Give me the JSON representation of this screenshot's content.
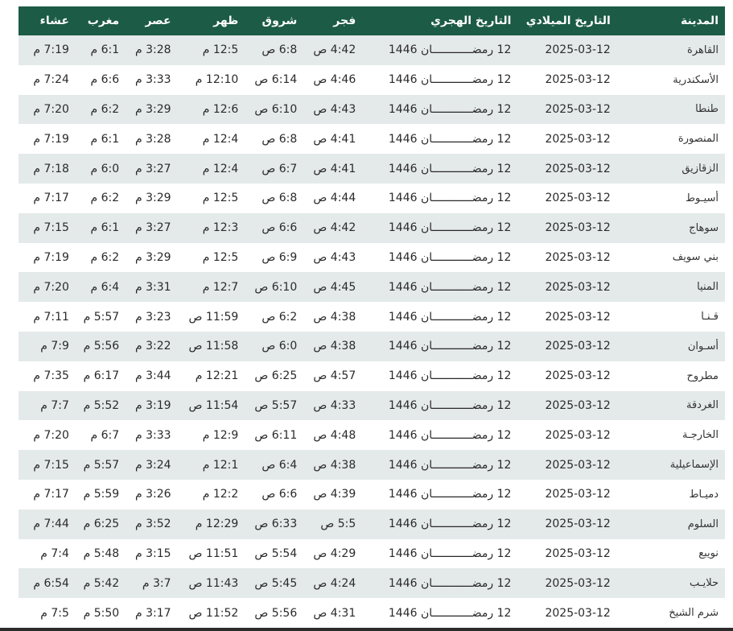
{
  "table": {
    "headers": {
      "city": "المدينة",
      "gregorian": "التاريخ الميلادي",
      "hijri": "التاريخ الهجري",
      "fajr": "فجر",
      "shuruq": "شروق",
      "dhuhr": "ظهر",
      "asr": "عصر",
      "maghrib": "مغرب",
      "isha": "عشاء"
    },
    "rows": [
      {
        "city": "القاهرة",
        "gregorian": "2025-03-12",
        "hijri": "12 رمضــــــــــــان 1446",
        "fajr": "4:42 ص",
        "shuruq": "6:8 ص",
        "dhuhr": "12:5 م",
        "asr": "3:28 م",
        "maghrib": "6:1 م",
        "isha": "7:19 م"
      },
      {
        "city": "الأسكندرية",
        "gregorian": "2025-03-12",
        "hijri": "12 رمضــــــــــــان 1446",
        "fajr": "4:46 ص",
        "shuruq": "6:14 ص",
        "dhuhr": "12:10 م",
        "asr": "3:33 م",
        "maghrib": "6:6 م",
        "isha": "7:24 م"
      },
      {
        "city": "طنطا",
        "gregorian": "2025-03-12",
        "hijri": "12 رمضــــــــــــان 1446",
        "fajr": "4:43 ص",
        "shuruq": "6:10 ص",
        "dhuhr": "12:6 م",
        "asr": "3:29 م",
        "maghrib": "6:2 م",
        "isha": "7:20 م"
      },
      {
        "city": "المنصورة",
        "gregorian": "2025-03-12",
        "hijri": "12 رمضــــــــــــان 1446",
        "fajr": "4:41 ص",
        "shuruq": "6:8 ص",
        "dhuhr": "12:4 م",
        "asr": "3:28 م",
        "maghrib": "6:1 م",
        "isha": "7:19 م"
      },
      {
        "city": "الزقازيق",
        "gregorian": "2025-03-12",
        "hijri": "12 رمضــــــــــــان 1446",
        "fajr": "4:41 ص",
        "shuruq": "6:7 ص",
        "dhuhr": "12:4 م",
        "asr": "3:27 م",
        "maghrib": "6:0 م",
        "isha": "7:18 م"
      },
      {
        "city": "أسيـوط",
        "gregorian": "2025-03-12",
        "hijri": "12 رمضــــــــــــان 1446",
        "fajr": "4:44 ص",
        "shuruq": "6:8 ص",
        "dhuhr": "12:5 م",
        "asr": "3:29 م",
        "maghrib": "6:2 م",
        "isha": "7:17 م"
      },
      {
        "city": "سوهاج",
        "gregorian": "2025-03-12",
        "hijri": "12 رمضــــــــــــان 1446",
        "fajr": "4:42 ص",
        "shuruq": "6:6 ص",
        "dhuhr": "12:3 م",
        "asr": "3:27 م",
        "maghrib": "6:1 م",
        "isha": "7:15 م"
      },
      {
        "city": "بني سويف",
        "gregorian": "2025-03-12",
        "hijri": "12 رمضــــــــــــان 1446",
        "fajr": "4:43 ص",
        "shuruq": "6:9 ص",
        "dhuhr": "12:5 م",
        "asr": "3:29 م",
        "maghrib": "6:2 م",
        "isha": "7:19 م"
      },
      {
        "city": "المنيا",
        "gregorian": "2025-03-12",
        "hijri": "12 رمضــــــــــــان 1446",
        "fajr": "4:45 ص",
        "shuruq": "6:10 ص",
        "dhuhr": "12:7 م",
        "asr": "3:31 م",
        "maghrib": "6:4 م",
        "isha": "7:20 م"
      },
      {
        "city": "قـنـا",
        "gregorian": "2025-03-12",
        "hijri": "12 رمضــــــــــــان 1446",
        "fajr": "4:38 ص",
        "shuruq": "6:2 ص",
        "dhuhr": "11:59 ص",
        "asr": "3:23 م",
        "maghrib": "5:57 م",
        "isha": "7:11 م"
      },
      {
        "city": "أسـوان",
        "gregorian": "2025-03-12",
        "hijri": "12 رمضــــــــــــان 1446",
        "fajr": "4:38 ص",
        "shuruq": "6:0 ص",
        "dhuhr": "11:58 ص",
        "asr": "3:22 م",
        "maghrib": "5:56 م",
        "isha": "7:9 م"
      },
      {
        "city": "مطروح",
        "gregorian": "2025-03-12",
        "hijri": "12 رمضــــــــــــان 1446",
        "fajr": "4:57 ص",
        "shuruq": "6:25 ص",
        "dhuhr": "12:21 م",
        "asr": "3:44 م",
        "maghrib": "6:17 م",
        "isha": "7:35 م"
      },
      {
        "city": "الغردقة",
        "gregorian": "2025-03-12",
        "hijri": "12 رمضــــــــــــان 1446",
        "fajr": "4:33 ص",
        "shuruq": "5:57 ص",
        "dhuhr": "11:54 ص",
        "asr": "3:19 م",
        "maghrib": "5:52 م",
        "isha": "7:7 م"
      },
      {
        "city": "الخارجـة",
        "gregorian": "2025-03-12",
        "hijri": "12 رمضــــــــــــان 1446",
        "fajr": "4:48 ص",
        "shuruq": "6:11 ص",
        "dhuhr": "12:9 م",
        "asr": "3:33 م",
        "maghrib": "6:7 م",
        "isha": "7:20 م"
      },
      {
        "city": "الإسماعيلية",
        "gregorian": "2025-03-12",
        "hijri": "12 رمضــــــــــــان 1446",
        "fajr": "4:38 ص",
        "shuruq": "6:4 ص",
        "dhuhr": "12:1 م",
        "asr": "3:24 م",
        "maghrib": "5:57 م",
        "isha": "7:15 م"
      },
      {
        "city": "دميـاط",
        "gregorian": "2025-03-12",
        "hijri": "12 رمضــــــــــــان 1446",
        "fajr": "4:39 ص",
        "shuruq": "6:6 ص",
        "dhuhr": "12:2 م",
        "asr": "3:26 م",
        "maghrib": "5:59 م",
        "isha": "7:17 م"
      },
      {
        "city": "السلوم",
        "gregorian": "2025-03-12",
        "hijri": "12 رمضــــــــــــان 1446",
        "fajr": "5:5 ص",
        "shuruq": "6:33 ص",
        "dhuhr": "12:29 م",
        "asr": "3:52 م",
        "maghrib": "6:25 م",
        "isha": "7:44 م"
      },
      {
        "city": "نويبع",
        "gregorian": "2025-03-12",
        "hijri": "12 رمضــــــــــــان 1446",
        "fajr": "4:29 ص",
        "shuruq": "5:54 ص",
        "dhuhr": "11:51 ص",
        "asr": "3:15 م",
        "maghrib": "5:48 م",
        "isha": "7:4 م"
      },
      {
        "city": "حلايـب",
        "gregorian": "2025-03-12",
        "hijri": "12 رمضــــــــــــان 1446",
        "fajr": "4:24 ص",
        "shuruq": "5:45 ص",
        "dhuhr": "11:43 ص",
        "asr": "3:7 م",
        "maghrib": "5:42 م",
        "isha": "6:54 م"
      },
      {
        "city": "شرم الشيخ",
        "gregorian": "2025-03-12",
        "hijri": "12 رمضــــــــــــان 1446",
        "fajr": "4:31 ص",
        "shuruq": "5:56 ص",
        "dhuhr": "11:52 ص",
        "asr": "3:17 م",
        "maghrib": "5:50 م",
        "isha": "7:5 م"
      }
    ]
  },
  "colors": {
    "header_bg": "#1c5b45",
    "header_text": "#ffffff",
    "row_odd": "#e4eae9",
    "row_even": "#ffffff"
  }
}
